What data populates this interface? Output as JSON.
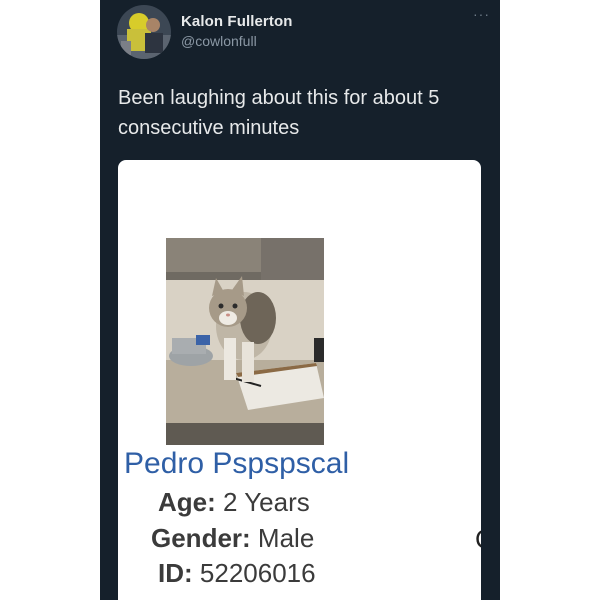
{
  "tweet": {
    "display_name": "Kalon Fullerton",
    "handle": "@cowlonfull",
    "more_label": "···",
    "text": "Been laughing about this for about 5 consecutive minutes",
    "avatar_icon": "user-avatar-icon"
  },
  "pet_card": {
    "photo_icon": "cat-photo",
    "name": "Pedro Pspspscal",
    "fields": [
      {
        "label": "Age:",
        "value": "2 Years"
      },
      {
        "label": "Gender:",
        "value": "Male"
      },
      {
        "label": "ID:",
        "value": "52206016"
      }
    ],
    "edge_glyph": "C"
  },
  "colors": {
    "tweet_background": "#15202b",
    "primary_text": "#e7e9ea",
    "secondary_text": "#8b98a5",
    "pet_name": "#2f5fa6",
    "card_text": "#3b3b3b",
    "card_background": "#ffffff"
  }
}
